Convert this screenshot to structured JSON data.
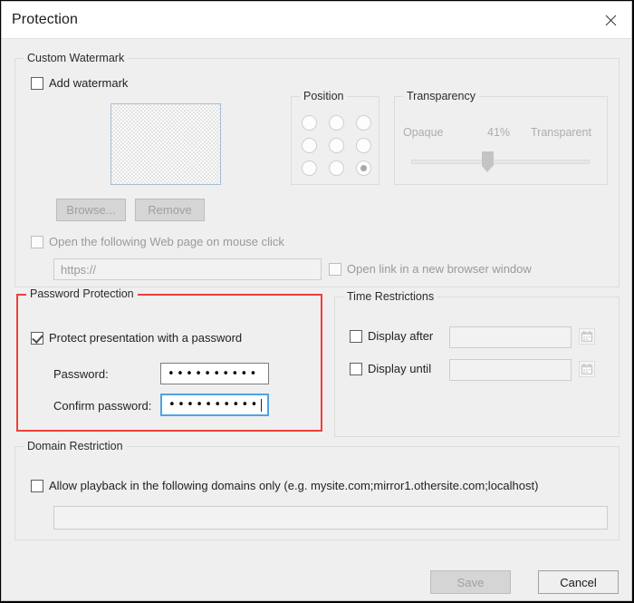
{
  "window": {
    "title": "Protection",
    "close_icon": "close-icon"
  },
  "watermark": {
    "legend": "Custom Watermark",
    "add_checkbox_label": "Add watermark",
    "add_checkbox_checked": false,
    "browse_button": "Browse...",
    "remove_button": "Remove",
    "weblink_checkbox_label": "Open the following Web page on mouse click",
    "weblink_checkbox_checked": false,
    "url_value": "https://",
    "newwindow_checkbox_label": "Open link in a new browser window",
    "newwindow_checkbox_checked": false,
    "position": {
      "legend": "Position",
      "selected_index": 8,
      "cells": 9
    },
    "transparency": {
      "legend": "Transparency",
      "left_label": "Opaque",
      "value_label": "41%",
      "right_label": "Transparent",
      "value": 41
    }
  },
  "password": {
    "legend": "Password Protection",
    "highlight_color": "#ef3f3a",
    "protect_checkbox_label": "Protect presentation with a password",
    "protect_checkbox_checked": true,
    "password_label": "Password:",
    "password_value": "••••••••••",
    "confirm_label": "Confirm password:",
    "confirm_value": "••••••••••"
  },
  "time": {
    "legend": "Time Restrictions",
    "after_label": "Display after",
    "after_checked": false,
    "after_value": "",
    "until_label": "Display until",
    "until_checked": false,
    "until_value": "",
    "calendar_icon": "calendar-icon"
  },
  "domain": {
    "legend": "Domain Restriction",
    "allow_checkbox_label": "Allow playback in the following domains only (e.g. mysite.com;mirror1.othersite.com;localhost)",
    "allow_checked": false,
    "domains_value": ""
  },
  "footer": {
    "save_label": "Save",
    "save_enabled": false,
    "cancel_label": "Cancel",
    "cancel_enabled": true
  }
}
